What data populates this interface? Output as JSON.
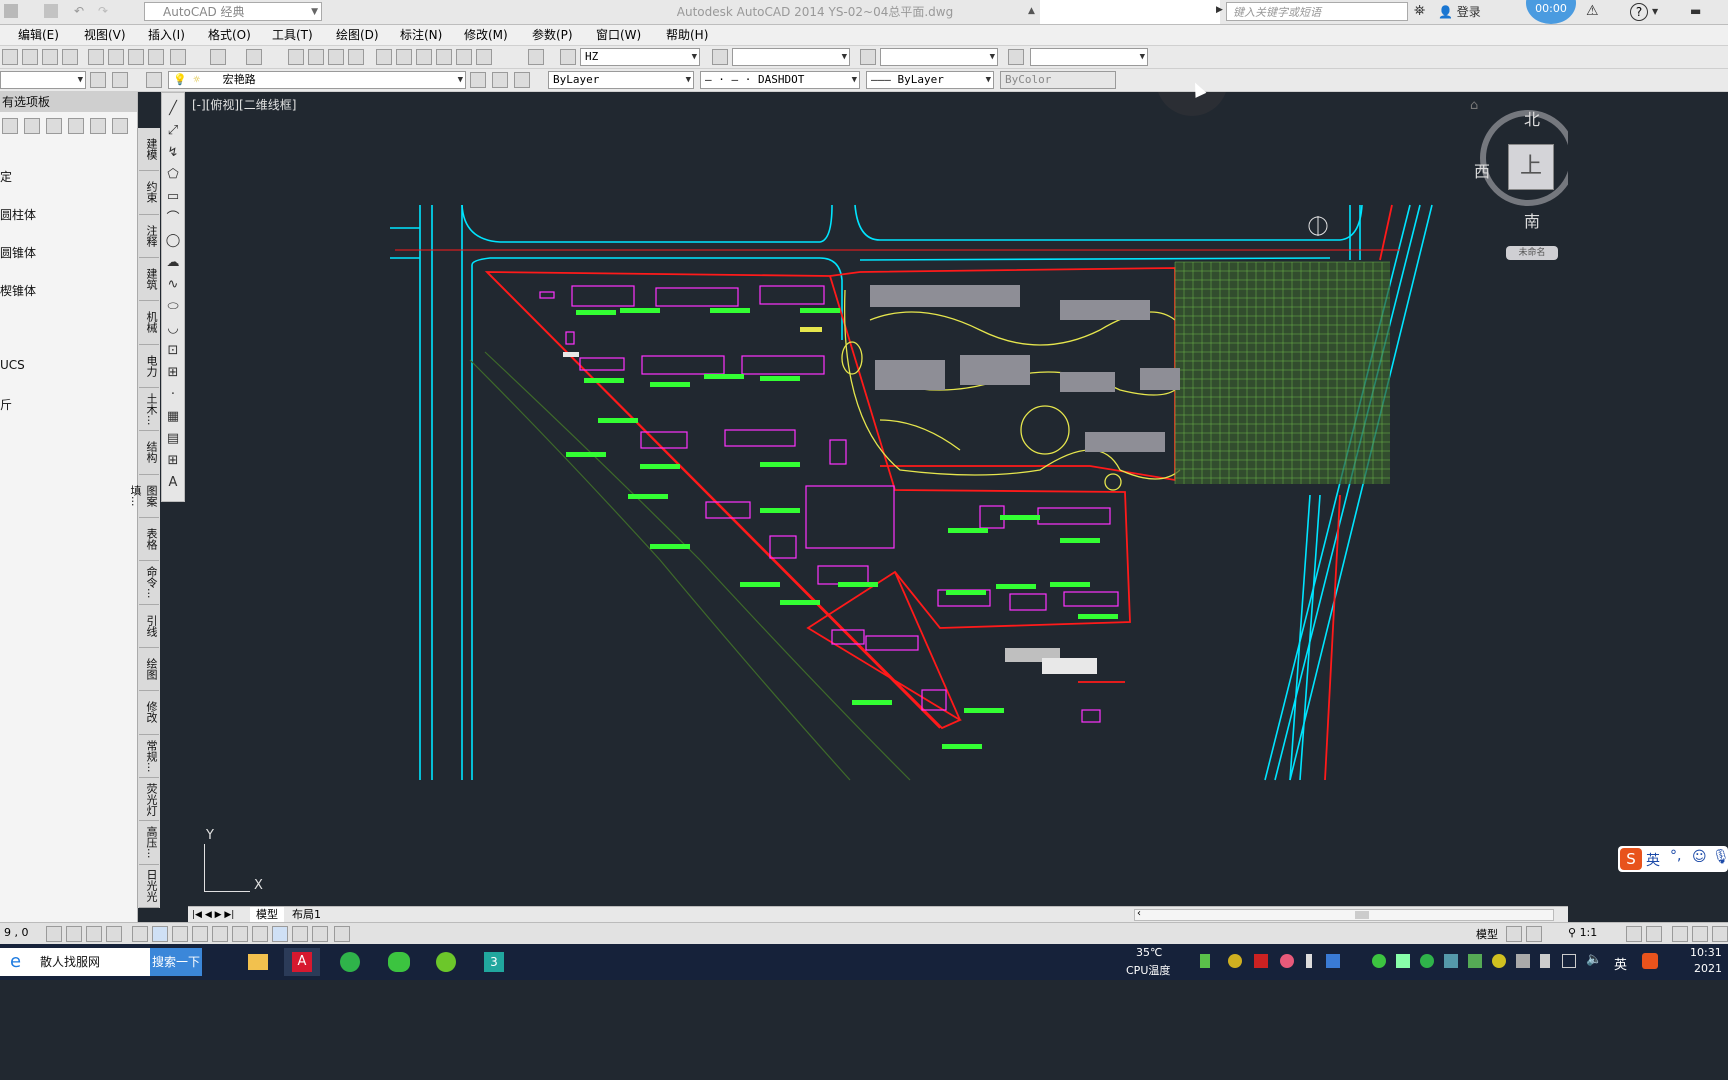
{
  "titlebar": {
    "workspace": "AutoCAD 经典",
    "title": "Autodesk AutoCAD 2014     YS-02~04总平面.dwg",
    "search_placeholder": "键入关键字或短语",
    "login": "登录",
    "help": "?",
    "clock_bubble": "00:00"
  },
  "menu": [
    "编辑(E)",
    "视图(V)",
    "插入(I)",
    "格式(O)",
    "工具(T)",
    "绘图(D)",
    "标注(N)",
    "修改(M)",
    "参数(P)",
    "窗口(W)",
    "帮助(H)"
  ],
  "toolbar": {
    "text_style": "HZ",
    "layer": "宏艳路",
    "color": "ByLayer",
    "linetype": "DASHDOT",
    "lineweight": "ByLayer",
    "plotstyle": "ByColor"
  },
  "palette": {
    "header": "有选项板",
    "items": [
      "定",
      "圆柱体",
      "圆锥体",
      "楔锥体",
      "UCS",
      "斤"
    ],
    "tabs": [
      "建模",
      "约束",
      "注释",
      "建筑",
      "机械",
      "电力",
      "土木...",
      "结构",
      "图案填...",
      "表格",
      "命令...",
      "引线",
      "绘图",
      "修改",
      "常规...",
      "荧光灯",
      "高压...",
      "日光光"
    ]
  },
  "canvas": {
    "view_label": "[-][俯视][二维线框]",
    "ucs_y": "Y",
    "ucs_x": "X"
  },
  "viewcube": {
    "north": "北",
    "south": "南",
    "west": "西",
    "top": "上",
    "wcs": "未命名"
  },
  "layout_tabs": [
    "模型",
    "布局1"
  ],
  "statusbar": {
    "coords": "9 , 0",
    "model": "模型",
    "scale": "1:1"
  },
  "taskbar": {
    "search_text": "散人找服网",
    "search_button": "搜索一下",
    "temperature": "35℃",
    "cpu_label": "CPU温度",
    "ime": "英",
    "time": "10:31",
    "date": "2021"
  },
  "sogou": {
    "label": "英"
  },
  "colors": {
    "canvas_bg": "#212830",
    "boundary_red": "#ff1a1a",
    "road_cyan": "#00e5ff",
    "building_magenta": "#ff33ff",
    "label_green": "#33ff33",
    "landscape_yellow": "#e6e64d"
  }
}
